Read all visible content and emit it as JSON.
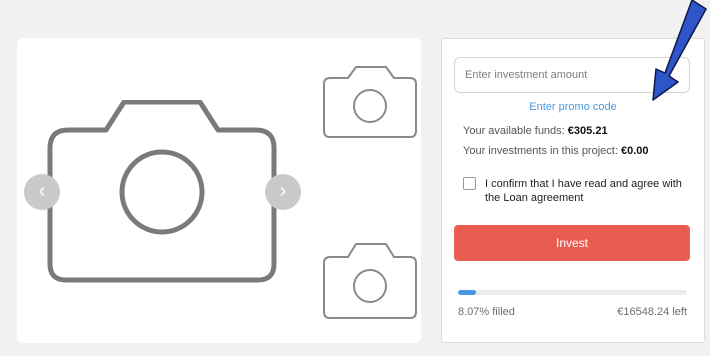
{
  "gallery": {
    "prev_glyph": "‹",
    "next_glyph": "›",
    "icons": [
      "camera-icon",
      "chevron-left-icon",
      "chevron-right-icon"
    ]
  },
  "invest_panel": {
    "amount_placeholder": "Enter investment amount",
    "amount_value": "",
    "promo_link": "Enter promo code",
    "available_funds_label": "Your available funds:",
    "available_funds_value": "€305.21",
    "project_investments_label": "Your investments in this project:",
    "project_investments_value": "€0.00",
    "agreement_label": "I confirm that I have read and agree with the Loan agreement",
    "agreement_checked": false,
    "invest_button": "Invest",
    "progress_percent": 8.07,
    "filled_text": "8.07% filled",
    "remaining_text": "€16548.24 left"
  },
  "colors": {
    "invest_button": "#e95c52",
    "accent_blue": "#4a98e0",
    "annotation_arrow": "#2f56c8"
  }
}
